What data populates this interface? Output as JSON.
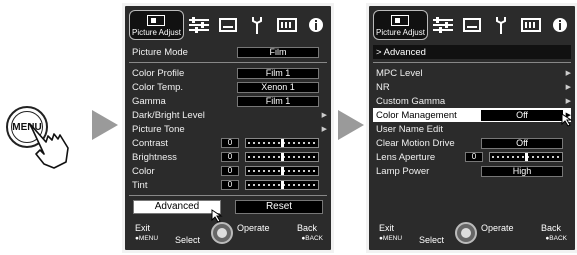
{
  "menu_button": {
    "label": "MENU"
  },
  "left_panel": {
    "tab_label": "Picture Adjust",
    "rows": {
      "picture_mode": {
        "label": "Picture Mode",
        "value": "Film"
      },
      "color_profile": {
        "label": "Color Profile",
        "value": "Film 1"
      },
      "color_temp": {
        "label": "Color Temp.",
        "value": "Xenon 1"
      },
      "gamma": {
        "label": "Gamma",
        "value": "Film 1"
      },
      "dark_bright": {
        "label": "Dark/Bright Level"
      },
      "picture_tone": {
        "label": "Picture Tone"
      },
      "contrast": {
        "label": "Contrast",
        "value": "0"
      },
      "brightness": {
        "label": "Brightness",
        "value": "0"
      },
      "color": {
        "label": "Color",
        "value": "0"
      },
      "tint": {
        "label": "Tint",
        "value": "0"
      }
    },
    "advanced_label": "Advanced",
    "reset_label": "Reset"
  },
  "right_panel": {
    "tab_label": "Picture Adjust",
    "header": "> Advanced",
    "rows": {
      "mpc_level": {
        "label": "MPC Level"
      },
      "nr": {
        "label": "NR"
      },
      "custom_gamma": {
        "label": "Custom Gamma"
      },
      "color_management": {
        "label": "Color Management",
        "value": "Off"
      },
      "user_name_edit": {
        "label": "User Name Edit"
      },
      "clear_motion_drive": {
        "label": "Clear Motion Drive",
        "value": "Off"
      },
      "lens_aperture": {
        "label": "Lens Aperture",
        "value": "0"
      },
      "lamp_power": {
        "label": "Lamp Power",
        "value": "High"
      }
    }
  },
  "footer": {
    "exit": "Exit",
    "exit_sub": "●MENU",
    "select": "Select",
    "operate": "Operate",
    "back": "Back",
    "back_sub": "●BACK"
  },
  "colors": {
    "panel_bg": "#2b2b2b",
    "highlight": "#ffffff",
    "arrow": "#9a9a9a"
  }
}
